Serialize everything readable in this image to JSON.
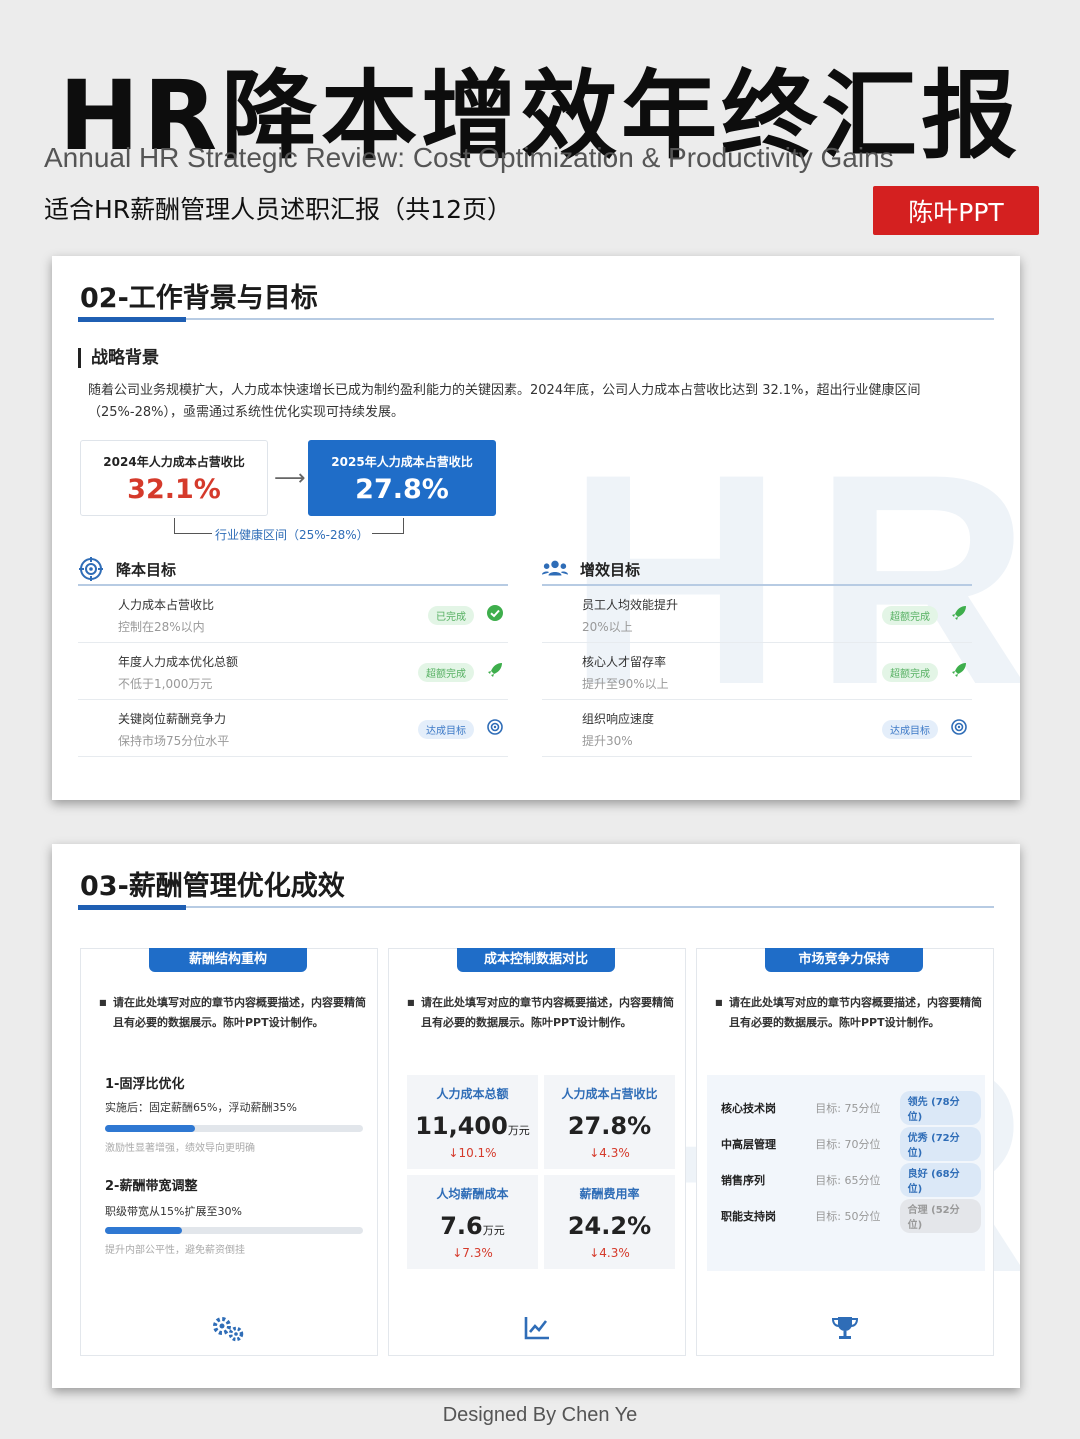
{
  "header": {
    "title": "HR降本增效年终汇报",
    "subtitle": "Annual HR Strategic Review: Cost Optimization & Productivity Gains",
    "description": "适合HR薪酬管理人员述职汇报（共12页）",
    "brand": "陈叶PPT"
  },
  "slide1": {
    "title": "02-工作背景与目标",
    "section": "战略背景",
    "intro": "随着公司业务规模扩大，人力成本快速增长已成为制约盈利能力的关键因素。2024年底，公司人力成本占营收比达到 32.1%，超出行业健康区间（25%-28%），亟需通过系统性优化实现可持续发展。",
    "stat_2024_label": "2024年人力成本占营收比",
    "stat_2024_value": "32.1%",
    "stat_2025_label": "2025年人力成本占营收比",
    "stat_2025_value": "27.8%",
    "range_label": "行业健康区间（25%-28%）",
    "cost_goals": {
      "title": "降本目标",
      "items": [
        {
          "name": "人力成本占营收比",
          "target": "控制在28%以内",
          "status": "已完成"
        },
        {
          "name": "年度人力成本优化总额",
          "target": "不低于1,000万元",
          "status": "超额完成"
        },
        {
          "name": "关键岗位薪酬竞争力",
          "target": "保持市场75分位水平",
          "status": "达成目标"
        }
      ]
    },
    "efficiency_goals": {
      "title": "增效目标",
      "items": [
        {
          "name": "员工人均效能提升",
          "target": "20%以上",
          "status": "超额完成"
        },
        {
          "name": "核心人才留存率",
          "target": "提升至90%以上",
          "status": "超额完成"
        },
        {
          "name": "组织响应速度",
          "target": "提升30%",
          "status": "达成目标"
        }
      ]
    }
  },
  "slide2": {
    "title": "03-薪酬管理优化成效",
    "card1": {
      "tab": "薪酬结构重构",
      "desc": "请在此处填写对应的章节内容概要描述，内容要精简且有必要的数据展示。陈叶PPT设计制作。",
      "items": [
        {
          "title": "1-固浮比优化",
          "sub": "实施后：固定薪酬65%，浮动薪酬35%",
          "note": "激励性显著增强，绩效导向更明确",
          "progress": 0.35
        },
        {
          "title": "2-薪酬带宽调整",
          "sub": "职级带宽从15%扩展至30%",
          "note": "提升内部公平性，避免薪资倒挂",
          "progress": 0.3
        }
      ]
    },
    "card2": {
      "tab": "成本控制数据对比",
      "desc": "请在此处填写对应的章节内容概要描述，内容要精简且有必要的数据展示。陈叶PPT设计制作。",
      "metrics": [
        {
          "label": "人力成本总额",
          "value": "11,400",
          "unit": "万元",
          "delta": "↓10.1%"
        },
        {
          "label": "人力成本占营收比",
          "value": "27.8%",
          "unit": "",
          "delta": "↓4.3%"
        },
        {
          "label": "人均薪酬成本",
          "value": "7.6",
          "unit": "万元",
          "delta": "↓7.3%"
        },
        {
          "label": "薪酬费用率",
          "value": "24.2%",
          "unit": "",
          "delta": "↓4.3%"
        }
      ]
    },
    "card3": {
      "tab": "市场竞争力保持",
      "desc": "请在此处填写对应的章节内容概要描述，内容要精简且有必要的数据展示。陈叶PPT设计制作。",
      "rows": [
        {
          "role": "核心技术岗",
          "target": "目标: 75分位",
          "level": "领先 (78分位)"
        },
        {
          "role": "中高层管理",
          "target": "目标: 70分位",
          "level": "优秀 (72分位)"
        },
        {
          "role": "销售序列",
          "target": "目标: 65分位",
          "level": "良好 (68分位)"
        },
        {
          "role": "职能支持岗",
          "target": "目标: 50分位",
          "level": "合理 (52分位)"
        }
      ]
    }
  },
  "footer": "Designed By Chen Ye",
  "colors": {
    "brand_red": "#d42020",
    "accent_blue": "#1f6dc8",
    "highlight_red": "#d53a2b",
    "success_green": "#55b061"
  }
}
